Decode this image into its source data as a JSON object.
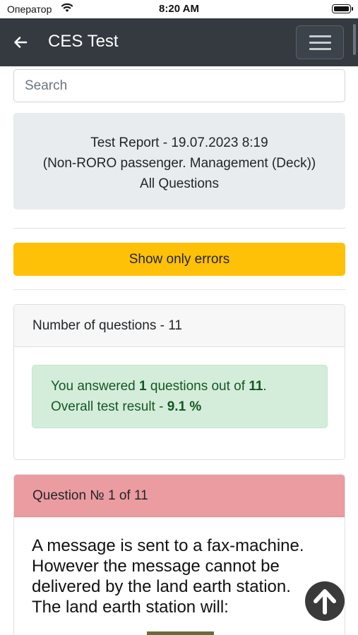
{
  "status_bar": {
    "carrier": "Оператор",
    "time": "8:20 AM"
  },
  "navbar": {
    "title": "CES Test",
    "back_icon": "arrow-left-icon",
    "menu_icon": "hamburger-icon"
  },
  "search": {
    "placeholder": "Search"
  },
  "report": {
    "line1": "Test Report - 19.07.2023 8:19",
    "line2": "(Non-RORO passenger. Management (Deck))",
    "line3": "All Questions"
  },
  "errors_button": {
    "label": "Show only errors"
  },
  "result_card": {
    "header": "Number of questions - 11",
    "text_prefix": "You answered ",
    "answered": "1",
    "text_middle": " questions out of ",
    "total": "11",
    "text_end": ".",
    "result_label": "Overall test result - ",
    "result_value": "9.1 %"
  },
  "question_card": {
    "header": "Question № 1 of 11",
    "text": "A message is sent to a fax-machine. However the message cannot be delivered by the land earth station. The land earth station will:"
  },
  "colors": {
    "navbar": "#343a40",
    "warning": "#ffc107",
    "success_bg": "#d4edda",
    "success_text": "#155724",
    "danger_header": "#eb9ca1"
  },
  "scroll_top_icon": "arrow-up-circle-icon"
}
